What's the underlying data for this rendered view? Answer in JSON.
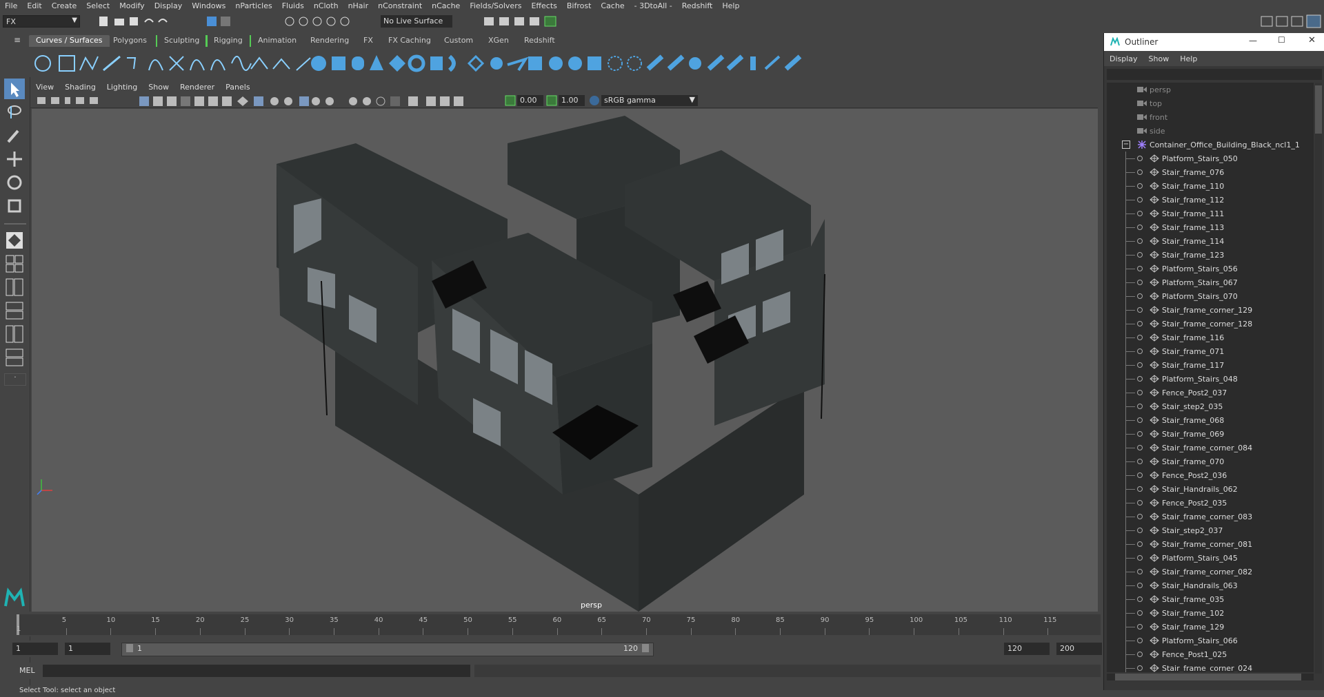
{
  "menubar": [
    "File",
    "Edit",
    "Create",
    "Select",
    "Modify",
    "Display",
    "Windows",
    "nParticles",
    "Fluids",
    "nCloth",
    "nHair",
    "nConstraint",
    "nCache",
    "Fields/Solvers",
    "Effects",
    "Bifrost",
    "Cache",
    "- 3DtoAll -",
    "Redshift",
    "Help"
  ],
  "statusline": {
    "mode": "FX",
    "live_surface": "No Live Surface"
  },
  "shelf_tabs": [
    "Curves / Surfaces",
    "Polygons",
    "Sculpting",
    "Rigging",
    "Animation",
    "Rendering",
    "FX",
    "FX Caching",
    "Custom",
    "XGen",
    "Redshift"
  ],
  "active_shelf_tab": "Curves / Surfaces",
  "viewport": {
    "menu": [
      "View",
      "Shading",
      "Lighting",
      "Show",
      "Renderer",
      "Panels"
    ],
    "exposure": "0.00",
    "gamma": "1.00",
    "color_space": "sRGB gamma",
    "camera_label": "persp"
  },
  "timeline": {
    "ticks": [
      "5",
      "10",
      "15",
      "20",
      "25",
      "30",
      "35",
      "40",
      "45",
      "50",
      "55",
      "60",
      "65",
      "70",
      "75",
      "80",
      "85",
      "90",
      "95",
      "100",
      "105",
      "110",
      "115"
    ],
    "current_frame_marker": "1"
  },
  "range": {
    "start": "1",
    "playback_start": "1",
    "slider_start": "1",
    "slider_end": "120",
    "playback_end": "120",
    "end": "200"
  },
  "cmdline": {
    "label": "MEL"
  },
  "helpline": "Select Tool: select an object",
  "outliner": {
    "title": "Outliner",
    "menu": [
      "Display",
      "Show",
      "Help"
    ],
    "cameras": [
      "persp",
      "top",
      "front",
      "side"
    ],
    "root": "Container_Office_Building_Black_ncl1_1",
    "children": [
      "Platform_Stairs_050",
      "Stair_frame_076",
      "Stair_frame_110",
      "Stair_frame_112",
      "Stair_frame_111",
      "Stair_frame_113",
      "Stair_frame_114",
      "Stair_frame_123",
      "Platform_Stairs_056",
      "Platform_Stairs_067",
      "Platform_Stairs_070",
      "Stair_frame_corner_129",
      "Stair_frame_corner_128",
      "Stair_frame_116",
      "Stair_frame_071",
      "Stair_frame_117",
      "Platform_Stairs_048",
      "Fence_Post2_037",
      "Stair_step2_035",
      "Stair_frame_068",
      "Stair_frame_069",
      "Stair_frame_corner_084",
      "Stair_frame_070",
      "Fence_Post2_036",
      "Stair_Handrails_062",
      "Fence_Post2_035",
      "Stair_frame_corner_083",
      "Stair_step2_037",
      "Stair_frame_corner_081",
      "Platform_Stairs_045",
      "Stair_frame_corner_082",
      "Stair_Handrails_063",
      "Stair_frame_035",
      "Stair_frame_102",
      "Stair_frame_129",
      "Platform_Stairs_066",
      "Fence_Post1_025",
      "Stair_frame_corner_024"
    ]
  }
}
